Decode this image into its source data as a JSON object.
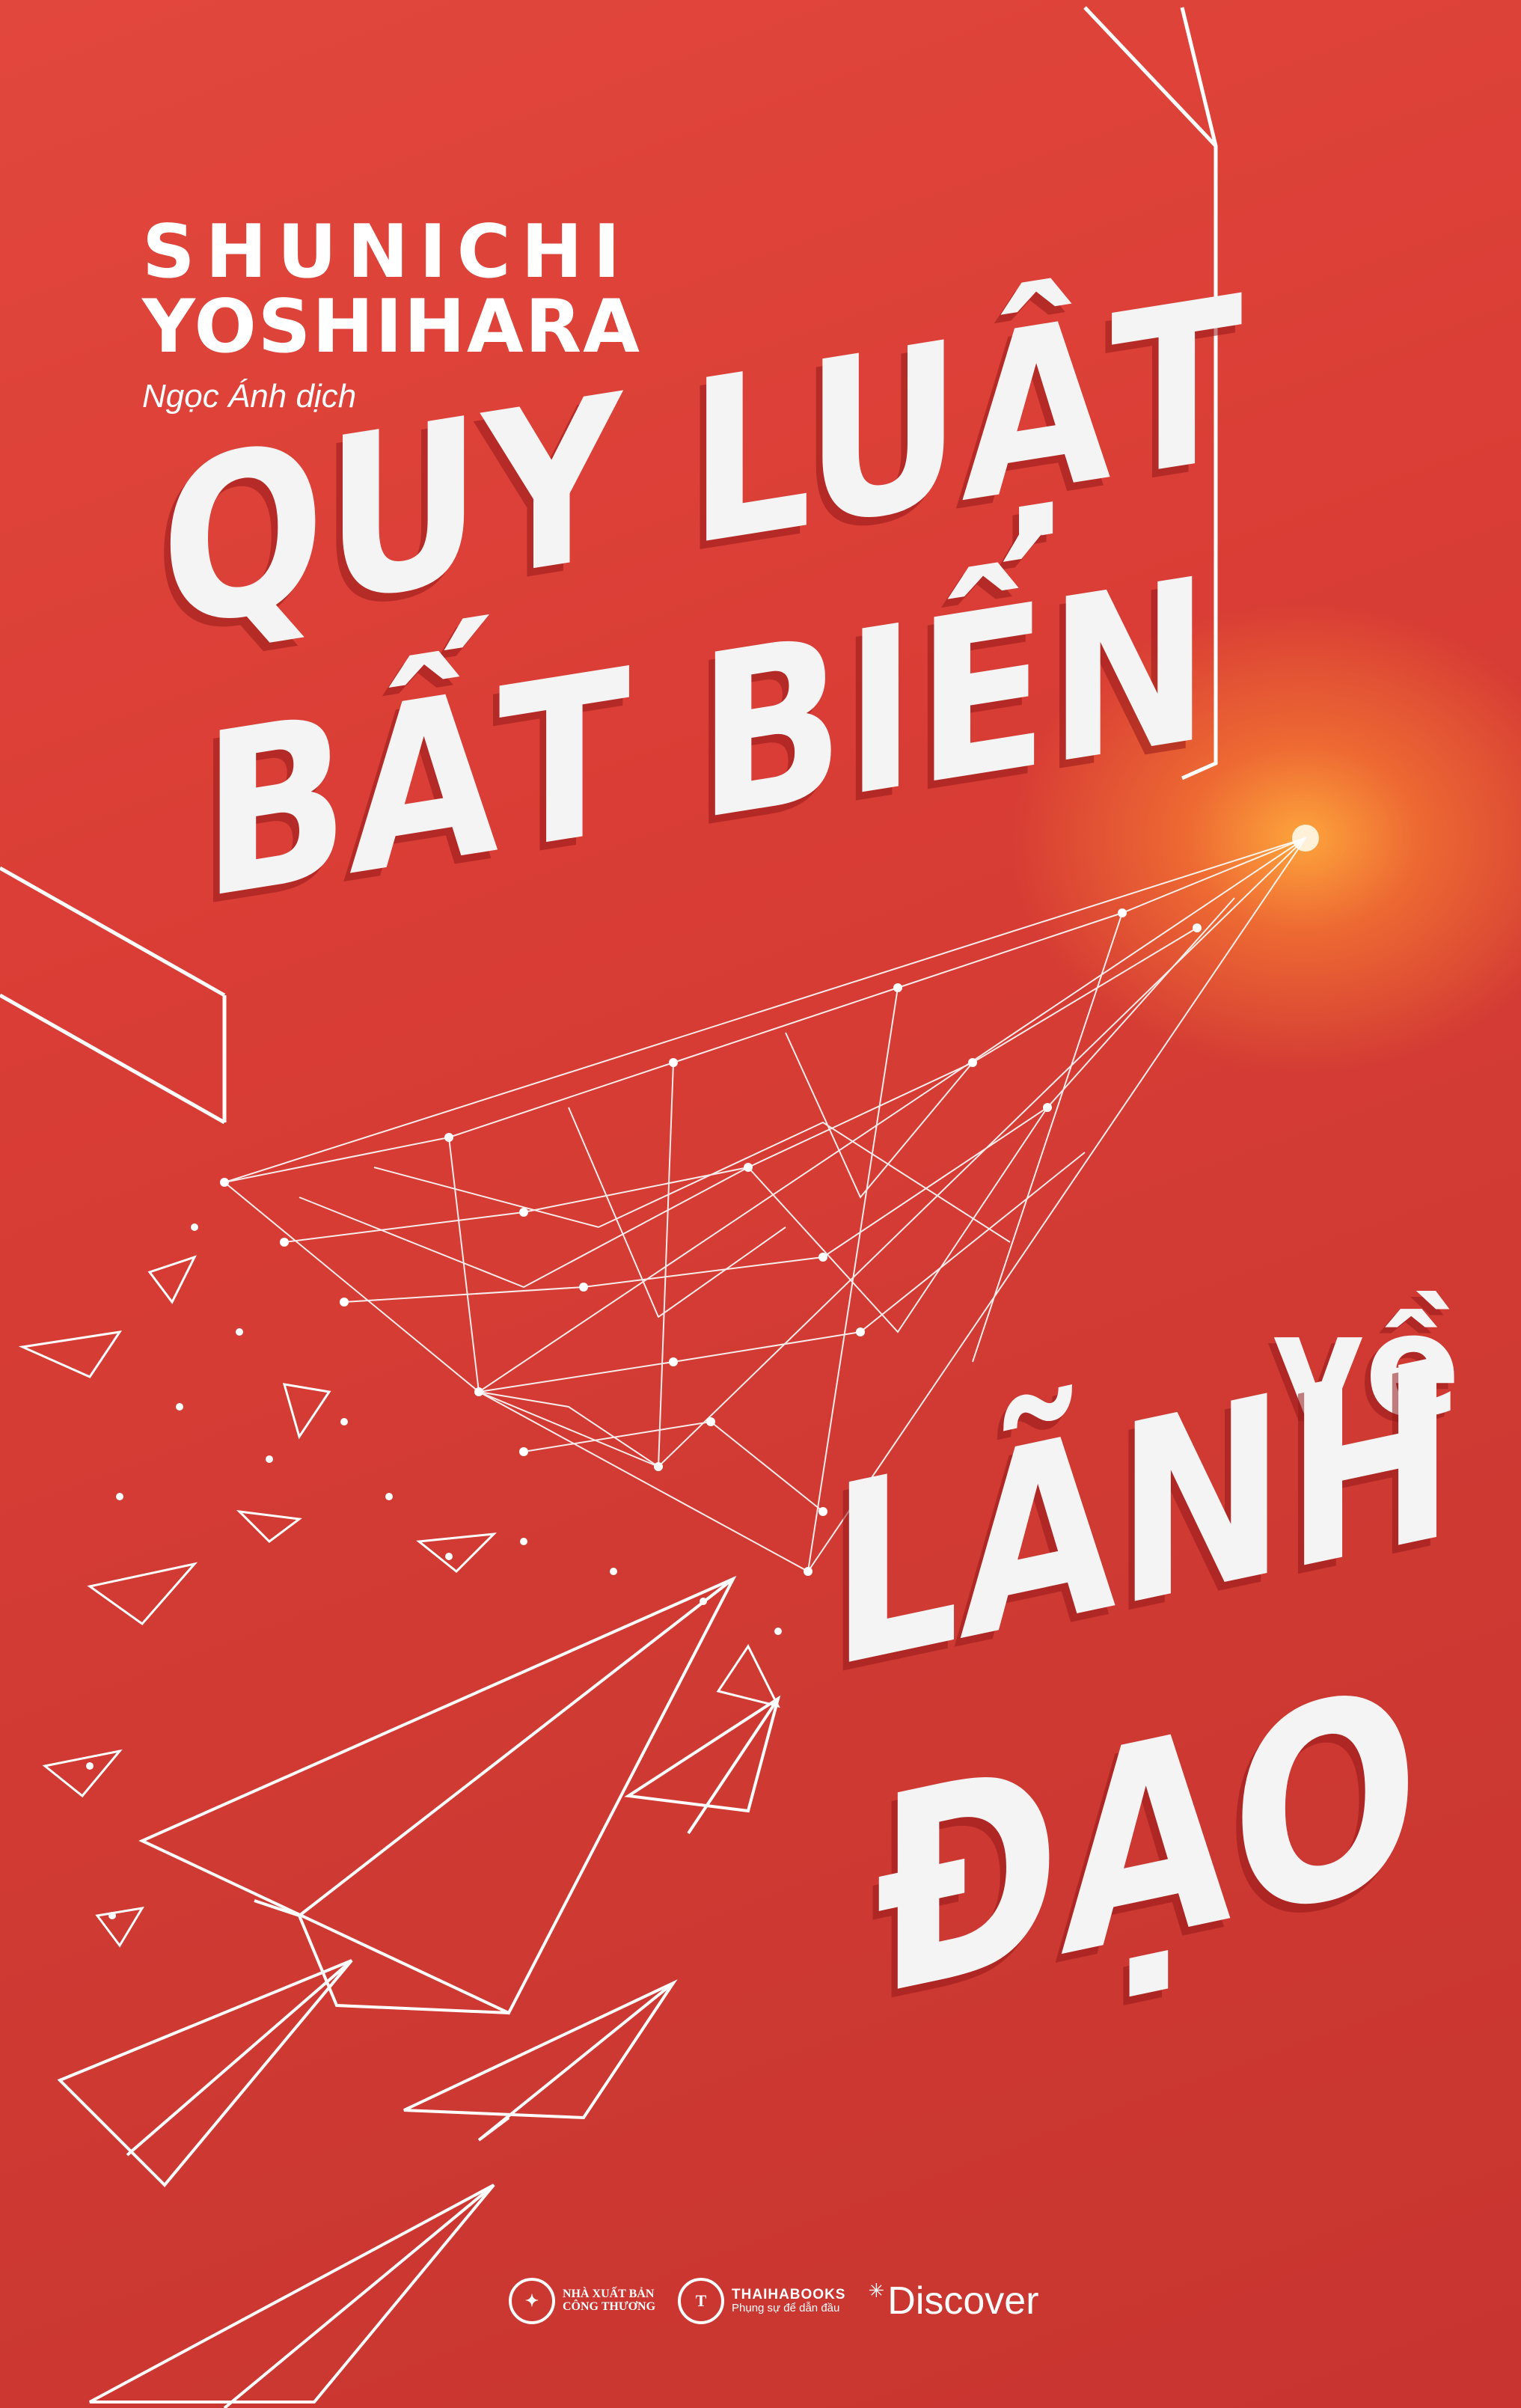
{
  "cover": {
    "author_first": "SHUNICHI",
    "author_last": "YOSHIHARA",
    "translator": "Ngọc Ánh dịch",
    "title_line1": "QUY LUẬT",
    "title_line2": "BẤT BIẾN",
    "connector": "về",
    "subject_line1": "LÃNH",
    "subject_line2": "ĐẠO",
    "colors": {
      "background": "#d43d36",
      "glow": "#f5a444",
      "text": "#f4f4f4"
    },
    "illustration": "paper-plane-network",
    "publishers": [
      {
        "name_line1": "NHÀ XUẤT BẢN",
        "name_line2": "CÔNG THƯƠNG",
        "icon": "publisher-emblem-icon"
      },
      {
        "name": "THAIHABOOKS",
        "tagline": "Phụng sự để dẫn đầu",
        "icon": "thaihabooks-logo-icon"
      },
      {
        "name": "Discover",
        "icon": "discover-star-icon"
      }
    ]
  }
}
